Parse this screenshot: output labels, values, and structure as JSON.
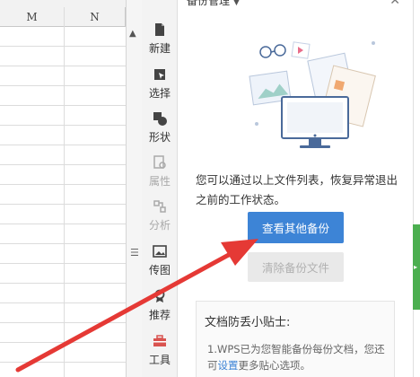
{
  "sheet": {
    "columns": [
      "M",
      "N"
    ]
  },
  "rail": {
    "items": [
      {
        "label": "新建",
        "icon": "new-file-icon",
        "enabled": true
      },
      {
        "label": "选择",
        "icon": "select-cursor-icon",
        "enabled": true
      },
      {
        "label": "形状",
        "icon": "shapes-icon",
        "enabled": true
      },
      {
        "label": "属性",
        "icon": "properties-icon",
        "enabled": false
      },
      {
        "label": "分析",
        "icon": "analysis-icon",
        "enabled": false
      },
      {
        "label": "传图",
        "icon": "image-upload-icon",
        "enabled": true
      },
      {
        "label": "推荐",
        "icon": "recommend-badge-icon",
        "enabled": true
      },
      {
        "label": "工具",
        "icon": "toolbox-icon",
        "enabled": true
      }
    ]
  },
  "panel": {
    "title": "备份管理",
    "description": "您可以通过以上文件列表，恢复异常退出之前的工作状态。",
    "primary_button": "查看其他备份",
    "disabled_button": "清除备份文件",
    "tips": {
      "title": "文档防丢小贴士:",
      "body_before": "1.WPS已为您智能备份每份文档，您还可",
      "link": "设置",
      "body_after": "更多贴心选项。"
    }
  },
  "colors": {
    "primary_button": "#3d84d6",
    "arrow": "#e53935",
    "edge_tab": "#4caf50"
  }
}
